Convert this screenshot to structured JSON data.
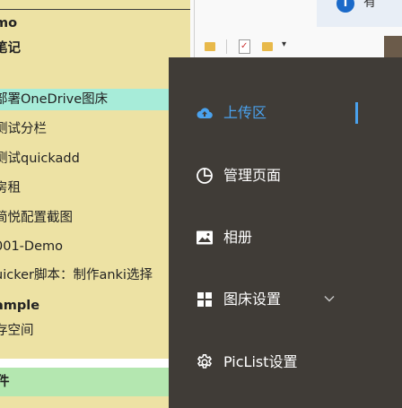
{
  "notes": {
    "items": [
      {
        "label": "mo",
        "bold": true
      },
      {
        "label": "笔记",
        "bold": true
      },
      {
        "label": "部署OneDrive图床",
        "selected": true
      },
      {
        "label": "测试分栏"
      },
      {
        "label": "测试quickadd"
      },
      {
        "label": "房租"
      },
      {
        "label": "简悦配置截图"
      },
      {
        "label": "001-Demo"
      },
      {
        "label": "uicker脚本：制作anki选择"
      },
      {
        "label": "ample",
        "bold": true
      },
      {
        "label": "存空间"
      }
    ],
    "footer_label": "件"
  },
  "notification": {
    "text": "有"
  },
  "menu": {
    "items": [
      {
        "label": "上传区",
        "icon": "cloud-upload-icon",
        "active": true
      },
      {
        "label": "管理页面",
        "icon": "pie-chart-icon"
      },
      {
        "label": "相册",
        "icon": "image-icon"
      },
      {
        "label": "图床设置",
        "icon": "grid-icon",
        "has_submenu": true
      },
      {
        "label": "PicList设置",
        "icon": "gear-icon"
      }
    ],
    "colors": {
      "background": "#403c37",
      "accent": "#4aa2ee"
    }
  }
}
